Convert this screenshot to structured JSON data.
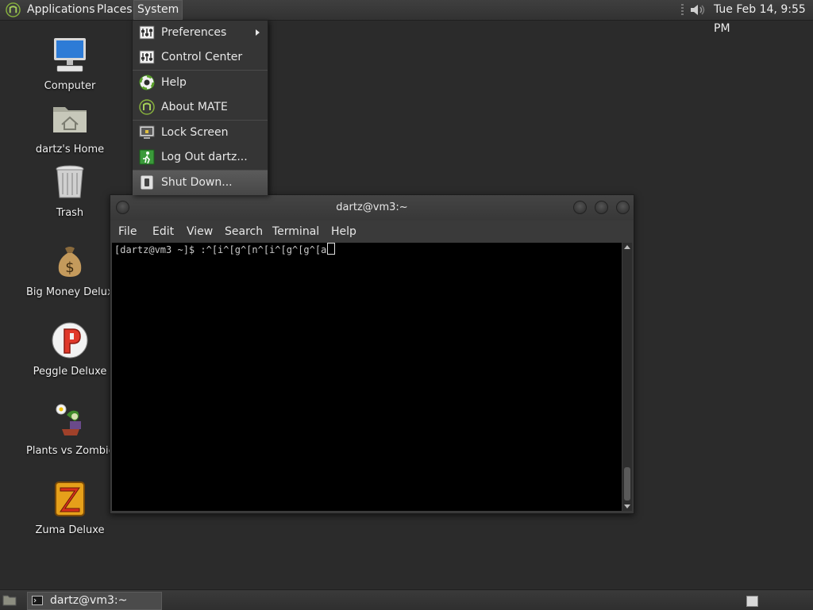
{
  "top_panel": {
    "menus": [
      "Applications",
      "Places",
      "System"
    ],
    "clock": "Tue Feb 14,  9:55 PM"
  },
  "desktop_icons": [
    {
      "label": "Computer",
      "icon": "computer-icon"
    },
    {
      "label": "dartz's Home",
      "icon": "home-folder-icon"
    },
    {
      "label": "Trash",
      "icon": "trash-icon"
    },
    {
      "label": "Big Money Deluxe",
      "icon": "money-bag-icon"
    },
    {
      "label": "Peggle Deluxe",
      "icon": "peggle-icon"
    },
    {
      "label": "Plants vs Zombies",
      "icon": "plants-vs-zombies-icon"
    },
    {
      "label": "Zuma Deluxe",
      "icon": "zuma-icon"
    }
  ],
  "system_menu": {
    "items": [
      {
        "label": "Preferences",
        "icon": "preferences-icon",
        "submenu": true
      },
      {
        "label": "Control Center",
        "icon": "control-center-icon"
      },
      {
        "label": "Help",
        "icon": "help-icon"
      },
      {
        "label": "About MATE",
        "icon": "mate-icon"
      },
      {
        "label": "Lock Screen",
        "icon": "lock-screen-icon"
      },
      {
        "label": "Log Out dartz...",
        "icon": "log-out-icon"
      },
      {
        "label": "Shut Down...",
        "icon": "shut-down-icon",
        "highlighted": true
      }
    ]
  },
  "terminal": {
    "title": "dartz@vm3:~",
    "menu": [
      "File",
      "Edit",
      "View",
      "Search",
      "Terminal",
      "Help"
    ],
    "prompt_line": "[dartz@vm3 ~]$ :^[i^[g^[n^[i^[g^[g^[a",
    "background": "#000000",
    "text_color": "#c8c8c8"
  },
  "taskbar": {
    "task_label": "dartz@vm3:~"
  },
  "colors": {
    "desktop": "#2b2b2b",
    "panel": "#383838",
    "menu": "#353535"
  }
}
